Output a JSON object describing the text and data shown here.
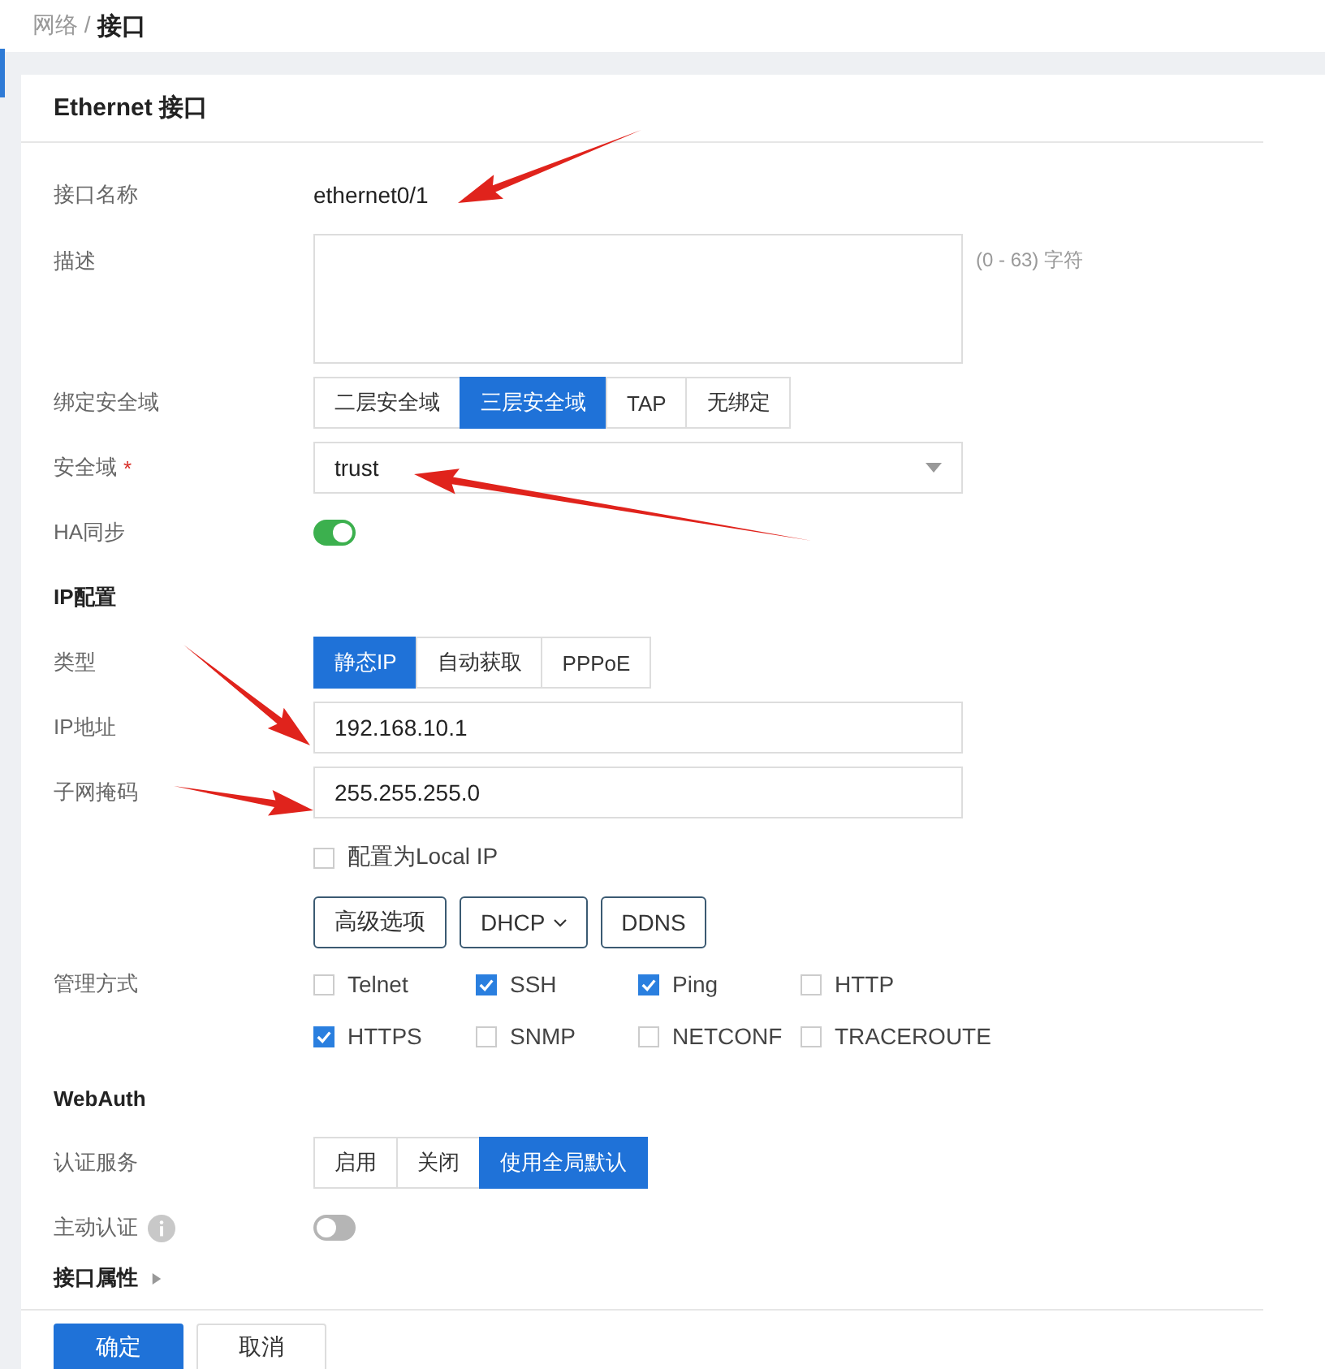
{
  "breadcrumb": {
    "parent": "网络 /",
    "current": "接口"
  },
  "card": {
    "title": "Ethernet 接口"
  },
  "rows": [
    {
      "kind": "text",
      "label": "接口名称",
      "value": "ethernet0/1"
    },
    {
      "kind": "textarea",
      "label": "描述",
      "hint": "(0 - 63) 字符"
    },
    {
      "kind": "segmented",
      "label": "绑定安全域",
      "options": [
        {
          "label": "二层安全域",
          "selected": false
        },
        {
          "label": "三层安全域",
          "selected": true
        },
        {
          "label": "TAP",
          "selected": false
        },
        {
          "label": "无绑定",
          "selected": false
        }
      ]
    },
    {
      "kind": "select",
      "label": "安全域",
      "required_mark": "*",
      "value": "trust"
    },
    {
      "kind": "toggle",
      "label": "HA同步",
      "info": false,
      "on": true
    },
    {
      "kind": "section",
      "title": "IP配置",
      "expander": false
    },
    {
      "kind": "segmented",
      "label": "类型",
      "options": [
        {
          "label": "静态IP",
          "selected": true
        },
        {
          "label": "自动获取",
          "selected": false
        },
        {
          "label": "PPPoE",
          "selected": false
        }
      ]
    },
    {
      "kind": "input",
      "label": "IP地址",
      "value": "192.168.10.1"
    },
    {
      "kind": "input",
      "label": "子网掩码",
      "value": "255.255.255.0"
    },
    {
      "kind": "checkbox",
      "text": "配置为Local IP",
      "checked": false
    },
    {
      "kind": "buttons",
      "buttons": [
        {
          "label": "高级选项",
          "dropdown": false
        },
        {
          "label": "DHCP",
          "dropdown": true
        },
        {
          "label": "DDNS",
          "dropdown": false
        }
      ]
    },
    {
      "kind": "checkgrid",
      "label": "管理方式",
      "options": [
        {
          "label": "Telnet",
          "checked": false
        },
        {
          "label": "SSH",
          "checked": true
        },
        {
          "label": "Ping",
          "checked": true
        },
        {
          "label": "HTTP",
          "checked": false
        },
        {
          "label": "HTTPS",
          "checked": true
        },
        {
          "label": "SNMP",
          "checked": false
        },
        {
          "label": "NETCONF",
          "checked": false
        },
        {
          "label": "TRACEROUTE",
          "checked": false
        }
      ]
    },
    {
      "kind": "section",
      "title": "WebAuth",
      "expander": false
    },
    {
      "kind": "segmented",
      "label": "认证服务",
      "options": [
        {
          "label": "启用",
          "selected": false
        },
        {
          "label": "关闭",
          "selected": false
        },
        {
          "label": "使用全局默认",
          "selected": true
        }
      ]
    },
    {
      "kind": "toggle",
      "label": "主动认证",
      "info": true,
      "on": false
    },
    {
      "kind": "section",
      "title": "接口属性",
      "expander": true
    }
  ],
  "footer": {
    "buttons": [
      {
        "label": "确定",
        "primary": true
      },
      {
        "label": "取消",
        "primary": false
      }
    ]
  }
}
